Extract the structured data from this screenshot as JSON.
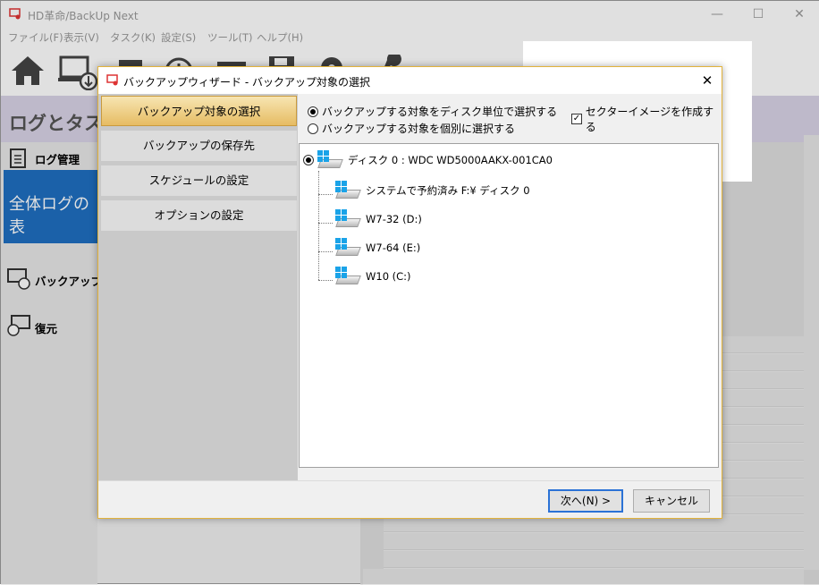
{
  "app": {
    "title": "HD革命/BackUp Next",
    "controls": {
      "minimize": "—",
      "maximize": "☐",
      "close": "✕"
    }
  },
  "menu": [
    "ファイル(F)",
    "表示(V)",
    "タスク(K)",
    "設定(S)",
    "ツール(T)",
    "ヘルプ(H)"
  ],
  "toolbar_icons": [
    "home-icon",
    "backup-pc-icon",
    "calendar-icon",
    "clock-icon",
    "monitor-icon",
    "floppy-icon",
    "gear-icon",
    "wrench-icon"
  ],
  "header": {
    "title": "ログとタスク"
  },
  "left_nav": {
    "log_label": "ログ管理",
    "all_logs": "全体ログの表",
    "backup_label": "バックアップ",
    "restore_label": "復元"
  },
  "dialog": {
    "title": "バックアップウィザード - バックアップ対象の選択",
    "close": "✕",
    "steps": [
      "バックアップ対象の選択",
      "バックアップの保存先",
      "スケジュールの設定",
      "オプションの設定"
    ],
    "selected_step": 0,
    "options": {
      "by_disk": "バックアップする対象をディスク単位で選択する",
      "individual": "バックアップする対象を個別に選択する",
      "sector_image": "セクターイメージを作成する",
      "by_disk_checked": true,
      "sector_image_checked": true
    },
    "tree": {
      "disk": "ディスク 0 : WDC WD5000AAKX-001CA0",
      "partitions": [
        "システムで予約済み F:¥ ディスク 0",
        "W7-32 (D:)",
        "W7-64 (E:)",
        "W10 (C:)"
      ]
    },
    "buttons": {
      "next": "次へ(N) >",
      "cancel": "キャンセル"
    }
  },
  "colors": {
    "accent_gold": "#e6bc63",
    "focus_blue": "#2b72d6",
    "windows_blue": "#1aa3e8"
  }
}
